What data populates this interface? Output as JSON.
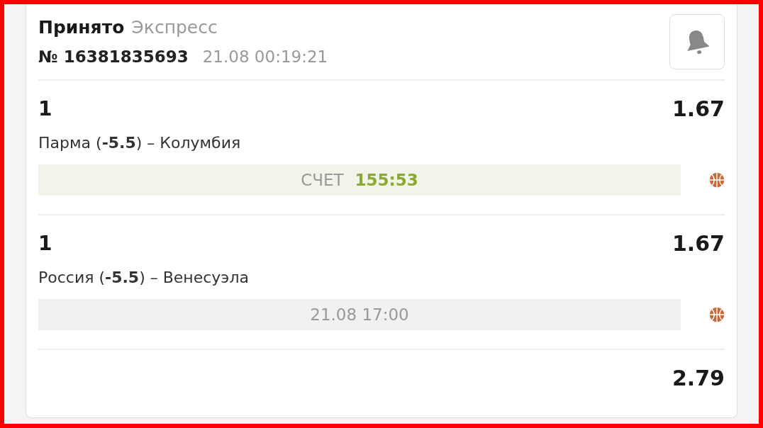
{
  "header": {
    "status": "Принято",
    "bet_type": "Экспресс",
    "number": "№ 16381835693",
    "datetime": "21.08 00:19:21"
  },
  "events": [
    {
      "pick": "1",
      "odds": "1.67",
      "teams": "Парма (**-5.5**) – Колумбия",
      "kind": "live",
      "score_label": "СЧЕТ",
      "score": "155:53"
    },
    {
      "pick": "1",
      "odds": "1.67",
      "teams": "Россия (**-5.5**) – Венесуэла",
      "kind": "scheduled",
      "start": "21.08 17:00"
    },
    {
      "odds": "2.79"
    }
  ]
}
